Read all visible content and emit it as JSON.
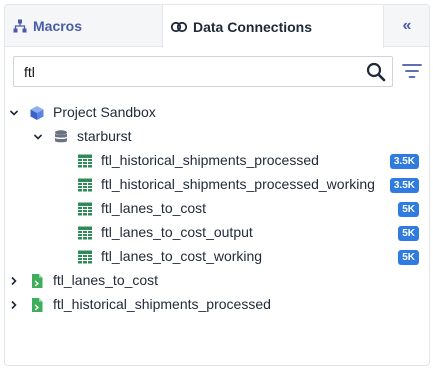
{
  "tabs": {
    "macros_label": "Macros",
    "data_connections_label": "Data Connections",
    "collapse_label": "«"
  },
  "search": {
    "value": "ftl",
    "placeholder": ""
  },
  "tree": {
    "project": {
      "label": "Project Sandbox",
      "expanded": true
    },
    "connection": {
      "label": "starburst",
      "expanded": true
    },
    "tables": [
      {
        "label": "ftl_historical_shipments_processed",
        "badge": "3.5K"
      },
      {
        "label": "ftl_historical_shipments_processed_working",
        "badge": "3.5K"
      },
      {
        "label": "ftl_lanes_to_cost",
        "badge": "5K"
      },
      {
        "label": "ftl_lanes_to_cost_output",
        "badge": "5K"
      },
      {
        "label": "ftl_lanes_to_cost_working",
        "badge": "5K"
      }
    ],
    "files": [
      {
        "label": "ftl_lanes_to_cost",
        "expanded": false
      },
      {
        "label": "ftl_historical_shipments_processed",
        "expanded": false
      }
    ]
  },
  "colors": {
    "accent": "#4a5ba8",
    "badge": "#2f7be0",
    "table_icon": "#2e8b57",
    "file_icon": "#3fae5a",
    "cube_icon": "#3a62c9"
  }
}
